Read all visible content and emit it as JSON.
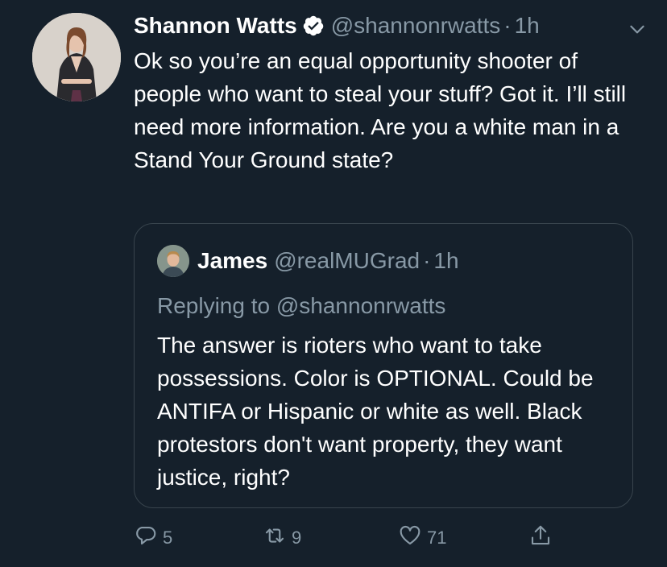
{
  "tweet": {
    "author": {
      "display_name": "Shannon Watts",
      "handle": "@shannonrwatts",
      "verified": true
    },
    "time": "1h",
    "separator": "·",
    "text": "Ok so you’re an equal opportunity shooter of people who want to steal your stuff? Got it. I’ll still need more information. Are you a white man in a Stand Your Ground state?",
    "quote": {
      "display_name": "James",
      "handle": "@realMUGrad",
      "separator": "·",
      "time": "1h",
      "replying_to": "Replying to @shannonrwatts",
      "text": "The answer is rioters who want to take possessions.  Color is OPTIONAL. Could be ANTIFA or Hispanic or white as well. Black protestors don't want property, they want justice, right?"
    },
    "actions": {
      "reply_count": "5",
      "retweet_count": "9",
      "like_count": "71"
    }
  },
  "colors": {
    "background": "#15202b",
    "text_primary": "#ffffff",
    "text_secondary": "#8899a6",
    "border": "#38444d"
  },
  "icons": [
    "verified-badge-icon",
    "chevron-down-icon",
    "reply-icon",
    "retweet-icon",
    "like-icon",
    "share-icon"
  ]
}
